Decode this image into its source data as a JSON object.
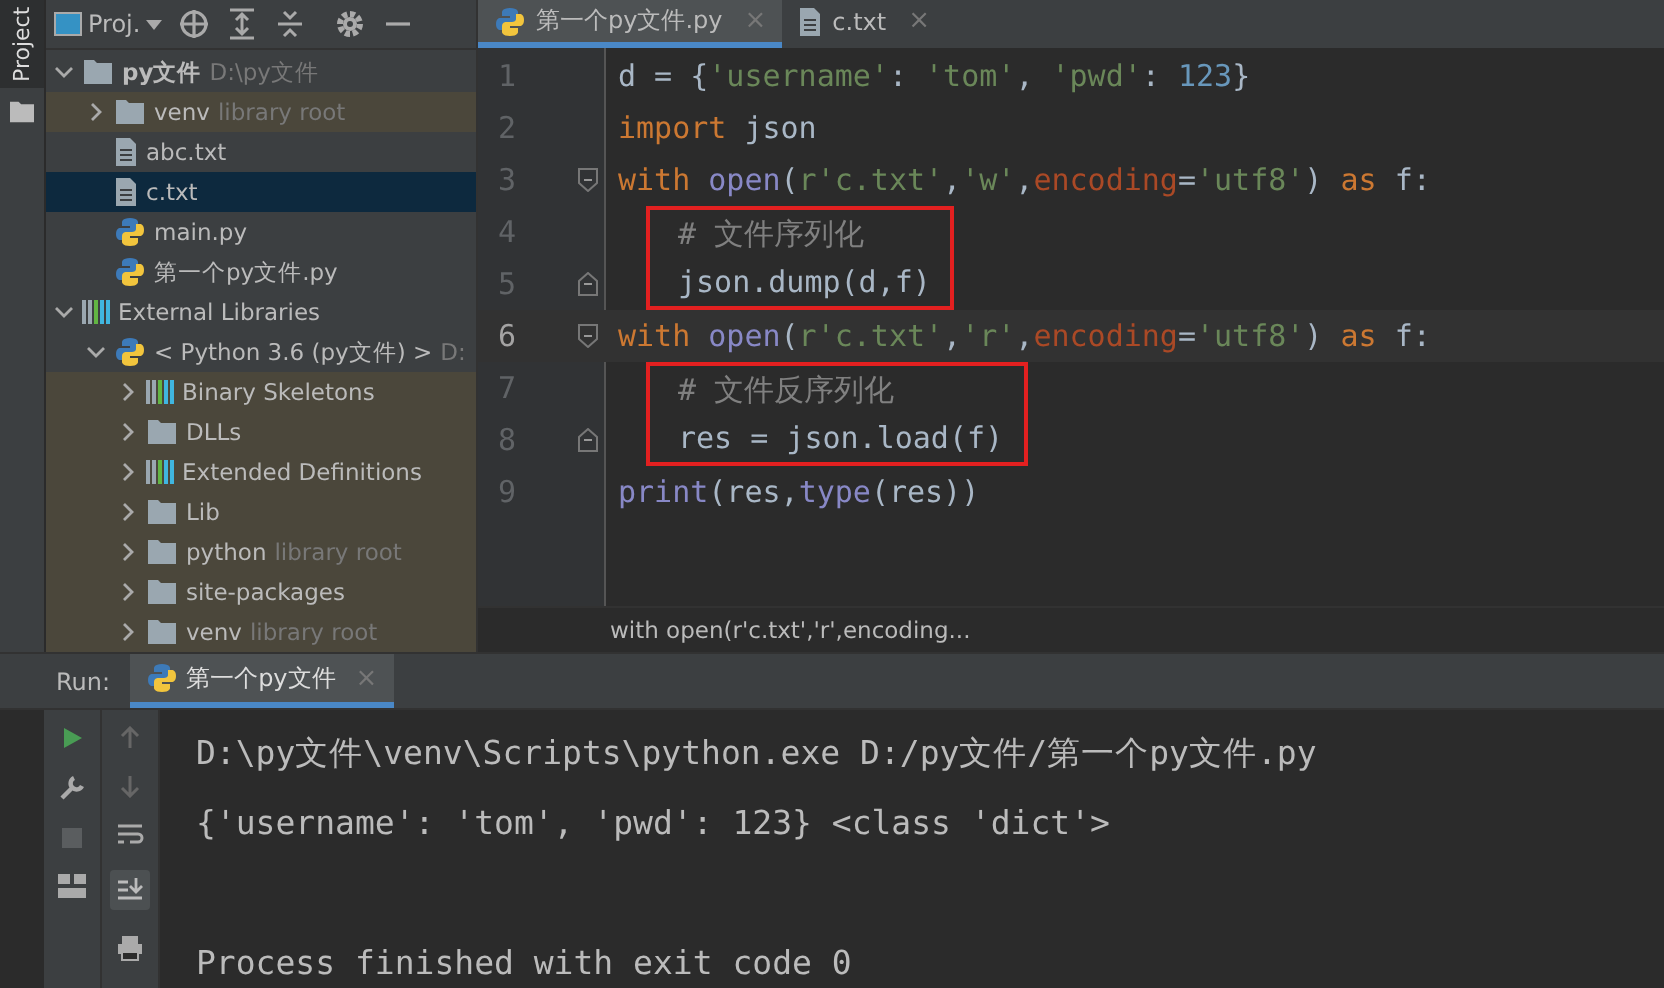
{
  "side_strip": {
    "label": "Project"
  },
  "project": {
    "title": "Proj.",
    "tree": [
      {
        "label": "py文件",
        "hint": "D:\\py文件",
        "kind": "folder",
        "bold": true,
        "expanded": true,
        "selected": false,
        "tinted": false,
        "children": [
          {
            "label": "venv",
            "hint": "library root",
            "kind": "folder",
            "expanded": false,
            "selected": false,
            "tinted": true
          },
          {
            "label": "abc.txt",
            "kind": "file",
            "selected": false,
            "tinted": false
          },
          {
            "label": "c.txt",
            "kind": "file",
            "selected": true,
            "tinted": false
          },
          {
            "label": "main.py",
            "kind": "python",
            "selected": false,
            "tinted": false
          },
          {
            "label": "第一个py文件.py",
            "kind": "python",
            "selected": false,
            "tinted": false
          }
        ]
      },
      {
        "label": "External Libraries",
        "kind": "library",
        "expanded": true,
        "selected": false,
        "tinted": false,
        "children": [
          {
            "label": "< Python 3.6 (py文件) >",
            "hint": "D:",
            "kind": "python",
            "expanded": true,
            "selected": false,
            "tinted": false,
            "children": [
              {
                "label": "Binary Skeletons",
                "kind": "library",
                "expanded": false,
                "selected": false,
                "tinted": true
              },
              {
                "label": "DLLs",
                "kind": "folder",
                "expanded": false,
                "selected": false,
                "tinted": true
              },
              {
                "label": "Extended Definitions",
                "kind": "library",
                "expanded": false,
                "selected": false,
                "tinted": true
              },
              {
                "label": "Lib",
                "kind": "folder",
                "expanded": false,
                "selected": false,
                "tinted": true
              },
              {
                "label": "python",
                "hint": "library root",
                "kind": "folder",
                "expanded": false,
                "selected": false,
                "tinted": true
              },
              {
                "label": "site-packages",
                "kind": "folder",
                "expanded": false,
                "selected": false,
                "tinted": true
              },
              {
                "label": "venv",
                "hint": "library root",
                "kind": "folder",
                "expanded": false,
                "selected": false,
                "tinted": true
              }
            ]
          }
        ]
      }
    ]
  },
  "editor": {
    "tabs": [
      {
        "label": "第一个py文件.py",
        "kind": "python",
        "selected": true,
        "close": "×"
      },
      {
        "label": "c.txt",
        "kind": "file",
        "selected": false,
        "close": "×"
      }
    ],
    "lines": [
      {
        "kind": "line",
        "number": "1",
        "current": false,
        "tokens": [
          {
            "kind": "plain",
            "text": "d = {"
          },
          {
            "kind": "string",
            "text": "'username'"
          },
          {
            "kind": "plain",
            "text": ": "
          },
          {
            "kind": "string",
            "text": "'tom'"
          },
          {
            "kind": "plain",
            "text": ", "
          },
          {
            "kind": "string",
            "text": "'pwd'"
          },
          {
            "kind": "plain",
            "text": ": "
          },
          {
            "kind": "number",
            "text": "123"
          },
          {
            "kind": "plain",
            "text": "}"
          }
        ]
      },
      {
        "kind": "line",
        "number": "2",
        "current": false,
        "tokens": [
          {
            "kind": "keyword",
            "text": "import"
          },
          {
            "kind": "plain",
            "text": " json"
          }
        ]
      },
      {
        "kind": "line",
        "number": "3",
        "current": false,
        "fold_start": true,
        "tokens": [
          {
            "kind": "keyword",
            "text": "with"
          },
          {
            "kind": "builtin",
            "text": "open"
          },
          {
            "kind": "plain",
            "text": "("
          },
          {
            "kind": "string",
            "text": "r'c.txt'"
          },
          {
            "kind": "plain",
            "text": ","
          },
          {
            "kind": "string",
            "text": "'w'"
          },
          {
            "kind": "plain",
            "text": ","
          },
          {
            "kind": "param",
            "text": "encoding"
          },
          {
            "kind": "plain",
            "text": "="
          },
          {
            "kind": "string",
            "text": "'utf8'"
          },
          {
            "kind": "plain",
            "text": ") "
          },
          {
            "kind": "keyword",
            "text": "as"
          },
          {
            "kind": "plain",
            "text": " f:"
          }
        ]
      },
      {
        "kind": "highlight",
        "lines": [
          {
            "number": "4",
            "current": false,
            "tokens": [
              {
                "kind": "comment",
                "text": "# 文件序列化"
              }
            ]
          },
          {
            "number": "5",
            "current": false,
            "fold_end": true,
            "tokens": [
              {
                "kind": "plain",
                "text": "json.dump(d,f)"
              }
            ]
          }
        ]
      },
      {
        "kind": "line",
        "number": "6",
        "current": true,
        "fold_start": true,
        "tokens": [
          {
            "kind": "keyword",
            "text": "with"
          },
          {
            "kind": "builtin",
            "text": "open"
          },
          {
            "kind": "plain",
            "text": "("
          },
          {
            "kind": "string",
            "text": "r'c.txt'"
          },
          {
            "kind": "plain",
            "text": ","
          },
          {
            "kind": "string",
            "text": "'r'"
          },
          {
            "kind": "plain",
            "text": ","
          },
          {
            "kind": "param",
            "text": "encoding"
          },
          {
            "kind": "plain",
            "text": "="
          },
          {
            "kind": "string",
            "text": "'utf8'"
          },
          {
            "kind": "plain",
            "text": ") "
          },
          {
            "kind": "keyword",
            "text": "as"
          },
          {
            "kind": "plain",
            "text": " f:"
          }
        ]
      },
      {
        "kind": "highlight",
        "lines": [
          {
            "number": "7",
            "current": false,
            "tokens": [
              {
                "kind": "comment",
                "text": "# 文件反序列化"
              }
            ]
          },
          {
            "number": "8",
            "current": false,
            "fold_end": true,
            "tokens": [
              {
                "kind": "plain",
                "text": "res = json.load(f)"
              }
            ]
          }
        ]
      },
      {
        "kind": "line",
        "number": "9",
        "current": false,
        "tokens": [
          {
            "kind": "builtin",
            "text": "print"
          },
          {
            "kind": "plain",
            "text": "(res,"
          },
          {
            "kind": "builtin",
            "text": "type"
          },
          {
            "kind": "plain",
            "text": "(res))"
          }
        ]
      }
    ],
    "breadcrumb": "with open(r'c.txt','r',encoding..."
  },
  "run": {
    "label": "Run:",
    "tab": {
      "label": "第一个py文件",
      "close": "×"
    },
    "command": "D:\\py文件\\venv\\Scripts\\python.exe D:/py文件/第一个py文件.py",
    "result": "{'username': 'tom', 'pwd': 123} <class 'dict'>",
    "exit_message": "Process finished with exit code 0"
  }
}
